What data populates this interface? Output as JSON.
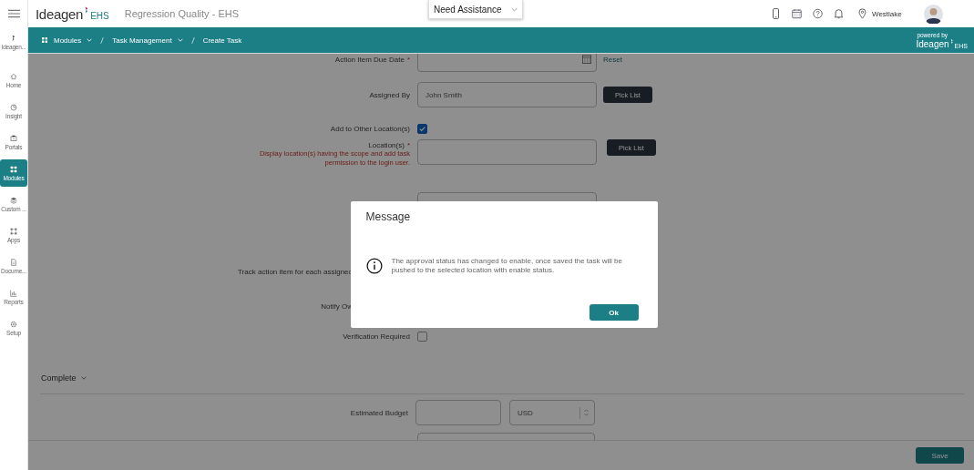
{
  "header": {
    "brand": "Ideagen",
    "brand_suffix": "EHS",
    "app_title": "Regression Quality - EHS",
    "assistance": "Need Assistance",
    "location": "Westlake"
  },
  "breadcrumb": {
    "items": [
      {
        "label": "Modules",
        "dropdown": true
      },
      {
        "label": "Task Management",
        "dropdown": true
      },
      {
        "label": "Create Task",
        "dropdown": false
      }
    ],
    "powered_by": "powered by",
    "brand": "Ideagen",
    "brand_suffix": "EHS"
  },
  "sidebar": {
    "items": [
      {
        "label": "Ideagen...",
        "selected": false
      },
      {
        "label": "Home",
        "selected": false
      },
      {
        "label": "Insight",
        "selected": false
      },
      {
        "label": "Portals",
        "selected": false
      },
      {
        "label": "Modules",
        "selected": true
      },
      {
        "label": "Custom ...",
        "selected": false
      },
      {
        "label": "Apps",
        "selected": false
      },
      {
        "label": "Docume...",
        "selected": false
      },
      {
        "label": "Reports",
        "selected": false
      },
      {
        "label": "Setup",
        "selected": false
      }
    ]
  },
  "form": {
    "rows": [
      {
        "kind": "date",
        "label": "Action Item Due Date",
        "required_mark": "*",
        "action": "Reset"
      },
      {
        "kind": "text",
        "label": "Assigned By",
        "value": "John Smith",
        "button": "Pick List"
      },
      {
        "kind": "checkbox",
        "label": "Add to Other Location(s)",
        "checked": true
      },
      {
        "kind": "text",
        "label": "Location(s)",
        "required_mark": "*",
        "hint": "Display location(s) having the scope and add task permission to the login user.",
        "button": "Pick List"
      },
      {
        "kind": "select"
      },
      {
        "kind": "cut",
        "label": "Track action item for each assigned"
      },
      {
        "kind": "cut",
        "label": "Notify Ow"
      },
      {
        "kind": "checkbox",
        "label": "Verification Required",
        "checked": false
      }
    ],
    "section": {
      "title": "Complete",
      "rows": [
        {
          "kind": "budget",
          "label": "Estimated Budget",
          "currency": "USD"
        },
        {
          "kind": "select"
        }
      ]
    }
  },
  "footer": {
    "button": "Save"
  },
  "modal": {
    "title": "Message",
    "message": "The approval status has changed to enable, once saved the task will be pushed to the selected location with enable status.",
    "button": "Ok"
  }
}
